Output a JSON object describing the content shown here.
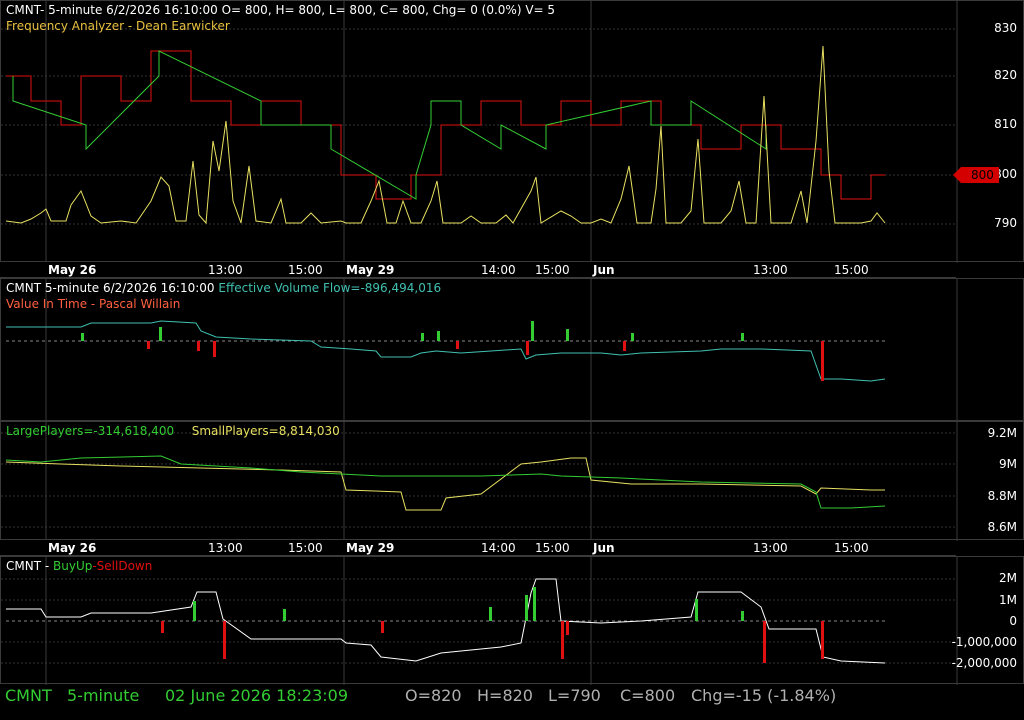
{
  "panel1": {
    "header_line1": "CMNT- 5-minute 6/2/2026 16:10:00 O= 800, H= 800, L= 800, C= 800, Chg= 0 (0.0%) V= 5",
    "header_line2": "Frequency Analyzer - Dean Earwicker",
    "y_labels": [
      "830",
      "820",
      "810",
      "800",
      "790"
    ],
    "price_tag": "800"
  },
  "time_axis": [
    "May 26",
    "13:00",
    "15:00",
    "May 29",
    "14:00",
    "15:00",
    "Jun",
    "13:00",
    "15:00"
  ],
  "panel2": {
    "header_symbol": "CMNT 5-minute  6/2/2026 16:10:00",
    "header_indicator": "Effective Volume Flow=-896,494,016",
    "header_line2": "Value In Time - Pascal Willain"
  },
  "panel3": {
    "large_label": "LargePlayers=-314,618,400",
    "small_label": "SmallPlayers=8,814,030",
    "y_labels": [
      "9.2M",
      "9M",
      "8.8M",
      "8.6M"
    ]
  },
  "panel4": {
    "header_prefix": "CMNT - ",
    "buy_label": "BuyUp",
    "sell_label": "-SellDown",
    "y_labels": [
      "2M",
      "1M",
      "0",
      "-1,000,000",
      "-2,000,000"
    ]
  },
  "status": {
    "symbol": "CMNT",
    "interval": "5-minute",
    "datetime": "02 June 2026 18:23:09",
    "open": "O=820",
    "high": "H=820",
    "low": "L=790",
    "close": "C=800",
    "change": "Chg=-15 (-1.84%)"
  },
  "colors": {
    "up": "#33cc33",
    "down": "#e01010",
    "yellow": "#e8e060",
    "cyan": "#40c0b0",
    "grid": "#333333",
    "status_green": "#33cc33",
    "status_gray": "#b0b0b0"
  }
}
